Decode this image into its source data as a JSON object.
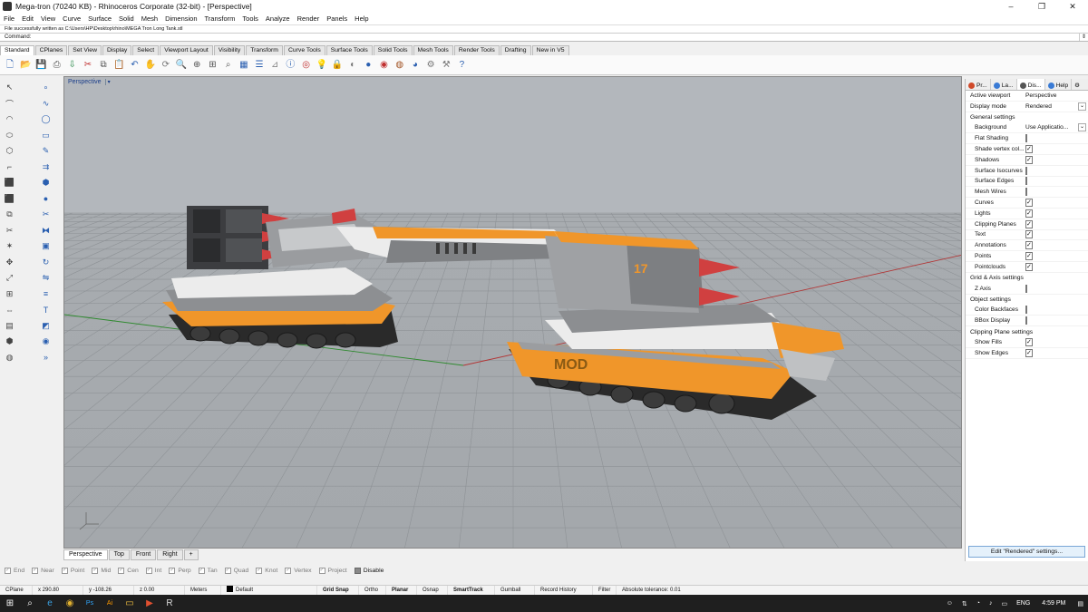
{
  "window": {
    "title": "Mega-tron (70240 KB) - Rhinoceros Corporate (32-bit) - [Perspective]",
    "controls": [
      "–",
      "❐",
      "✕"
    ]
  },
  "menu": [
    "File",
    "Edit",
    "View",
    "Curve",
    "Surface",
    "Solid",
    "Mesh",
    "Dimension",
    "Transform",
    "Tools",
    "Analyze",
    "Render",
    "Panels",
    "Help"
  ],
  "command": {
    "history": "File successfully written as C:\\Users\\HP\\Desktop\\rhino\\MEGA Tron Long Tank.stl",
    "prompt": "Command:",
    "value": ""
  },
  "toolbar_tabs": [
    "Standard",
    "CPlanes",
    "Set View",
    "Display",
    "Select",
    "Viewport Layout",
    "Visibility",
    "Transform",
    "Curve Tools",
    "Surface Tools",
    "Solid Tools",
    "Mesh Tools",
    "Render Tools",
    "Drafting",
    "New in V5"
  ],
  "toolbar_icons": [
    "new-file-icon",
    "open-file-icon",
    "save-icon",
    "print-icon",
    "import-icon",
    "cut-icon",
    "copy-icon",
    "paste-icon",
    "undo-icon",
    "pan-icon",
    "rotate-view-icon",
    "zoom-dynamic-icon",
    "zoom-window-icon",
    "zoom-extents-icon",
    "zoom-selected-icon",
    "four-views-icon",
    "layers-icon",
    "cplane-icon",
    "properties-icon",
    "osnap-icon",
    "light-icon",
    "lock-icon",
    "hide-icon",
    "shade-icon",
    "render-icon",
    "material-icon",
    "environment-icon",
    "options-icon",
    "tools-icon",
    "help-icon"
  ],
  "left_icons": [
    "select-icon",
    "point-icon",
    "polyline-icon",
    "curve-icon",
    "arc-icon",
    "circle-icon",
    "ellipse-icon",
    "rectangle-icon",
    "polygon-icon",
    "freeform-icon",
    "fillet-icon",
    "offset-icon",
    "extrude-icon",
    "surface-icon",
    "solid-box-icon",
    "sphere-icon",
    "boolean-icon",
    "split-icon",
    "trim-icon",
    "join-icon",
    "explode-icon",
    "group-icon",
    "move-icon",
    "rotate-icon",
    "scale-icon",
    "mirror-icon",
    "array-icon",
    "align-icon",
    "dimension-icon",
    "text-icon",
    "hatch-icon",
    "block-icon",
    "mesh-icon",
    "render-icon",
    "analyze-icon",
    "expand-icon"
  ],
  "viewport": {
    "label": "Perspective",
    "decal_front": "17",
    "decal_rear": "MOD"
  },
  "viewport_tabs": [
    "Perspective",
    "Top",
    "Front",
    "Right",
    "+"
  ],
  "osnaps": [
    {
      "label": "End",
      "on": false
    },
    {
      "label": "Near",
      "on": false
    },
    {
      "label": "Point",
      "on": false
    },
    {
      "label": "Mid",
      "on": false
    },
    {
      "label": "Cen",
      "on": false
    },
    {
      "label": "Int",
      "on": false
    },
    {
      "label": "Perp",
      "on": false
    },
    {
      "label": "Tan",
      "on": false
    },
    {
      "label": "Quad",
      "on": false
    },
    {
      "label": "Knot",
      "on": false
    },
    {
      "label": "Vertex",
      "on": false
    },
    {
      "label": "Project",
      "on": false
    },
    {
      "label": "Disable",
      "on": true
    }
  ],
  "status": {
    "cplane": "CPlane",
    "x": "x 290.80",
    "y": "y -108.26",
    "z": "z 0.00",
    "units": "Meters",
    "layer_swatch": "#000000",
    "layer": "Default",
    "grid_snap": "Grid Snap",
    "ortho": "Ortho",
    "planar": "Planar",
    "osnap": "Osnap",
    "smarttrack": "SmartTrack",
    "gumball": "Gumball",
    "record_history": "Record History",
    "filter": "Filter",
    "tolerance": "Absolute tolerance: 0.01"
  },
  "panel": {
    "tabs": [
      {
        "label": "Pr...",
        "color": "#d04a2a"
      },
      {
        "label": "La...",
        "color": "#3a7bd5"
      },
      {
        "label": "Dis...",
        "color": "#555555"
      },
      {
        "label": "Help",
        "color": "#3a7bd5"
      }
    ],
    "active_viewport_label": "Active viewport",
    "active_viewport_value": "Perspective",
    "display_mode_label": "Display mode",
    "display_mode_value": "Rendered",
    "general_header": "General settings",
    "background_label": "Background",
    "background_value": "Use Applicatio...",
    "general_items": [
      {
        "label": "Flat Shading",
        "checked": false
      },
      {
        "label": "Shade vertex col...",
        "checked": true
      },
      {
        "label": "Shadows",
        "checked": true
      },
      {
        "label": "Surface Isocurves",
        "checked": false
      },
      {
        "label": "Surface Edges",
        "checked": false
      },
      {
        "label": "Mesh Wires",
        "checked": false
      },
      {
        "label": "Curves",
        "checked": true
      },
      {
        "label": "Lights",
        "checked": true
      },
      {
        "label": "Clipping Planes",
        "checked": true
      },
      {
        "label": "Text",
        "checked": true
      },
      {
        "label": "Annotations",
        "checked": true
      },
      {
        "label": "Points",
        "checked": true
      },
      {
        "label": "Pointclouds",
        "checked": true
      }
    ],
    "grid_header": "Grid & Axis settings",
    "grid_items": [
      {
        "label": "Z Axis",
        "checked": false
      }
    ],
    "object_header": "Object settings",
    "object_items": [
      {
        "label": "Color Backfaces",
        "checked": false
      },
      {
        "label": "BBox Display",
        "checked": false
      }
    ],
    "clipping_header": "Clipping Plane settings",
    "clipping_items": [
      {
        "label": "Show Fills",
        "checked": true
      },
      {
        "label": "Show Edges",
        "checked": true
      }
    ],
    "edit_button": "Edit \"Rendered\" settings..."
  },
  "taskbar": {
    "icons": [
      "windows-icon",
      "search-icon",
      "edge-icon",
      "chrome-icon",
      "photoshop-icon",
      "illustrator-icon",
      "file-explorer-icon",
      "media-icon",
      "rhino-icon"
    ],
    "language": "ENG",
    "time": "4:59 PM"
  }
}
